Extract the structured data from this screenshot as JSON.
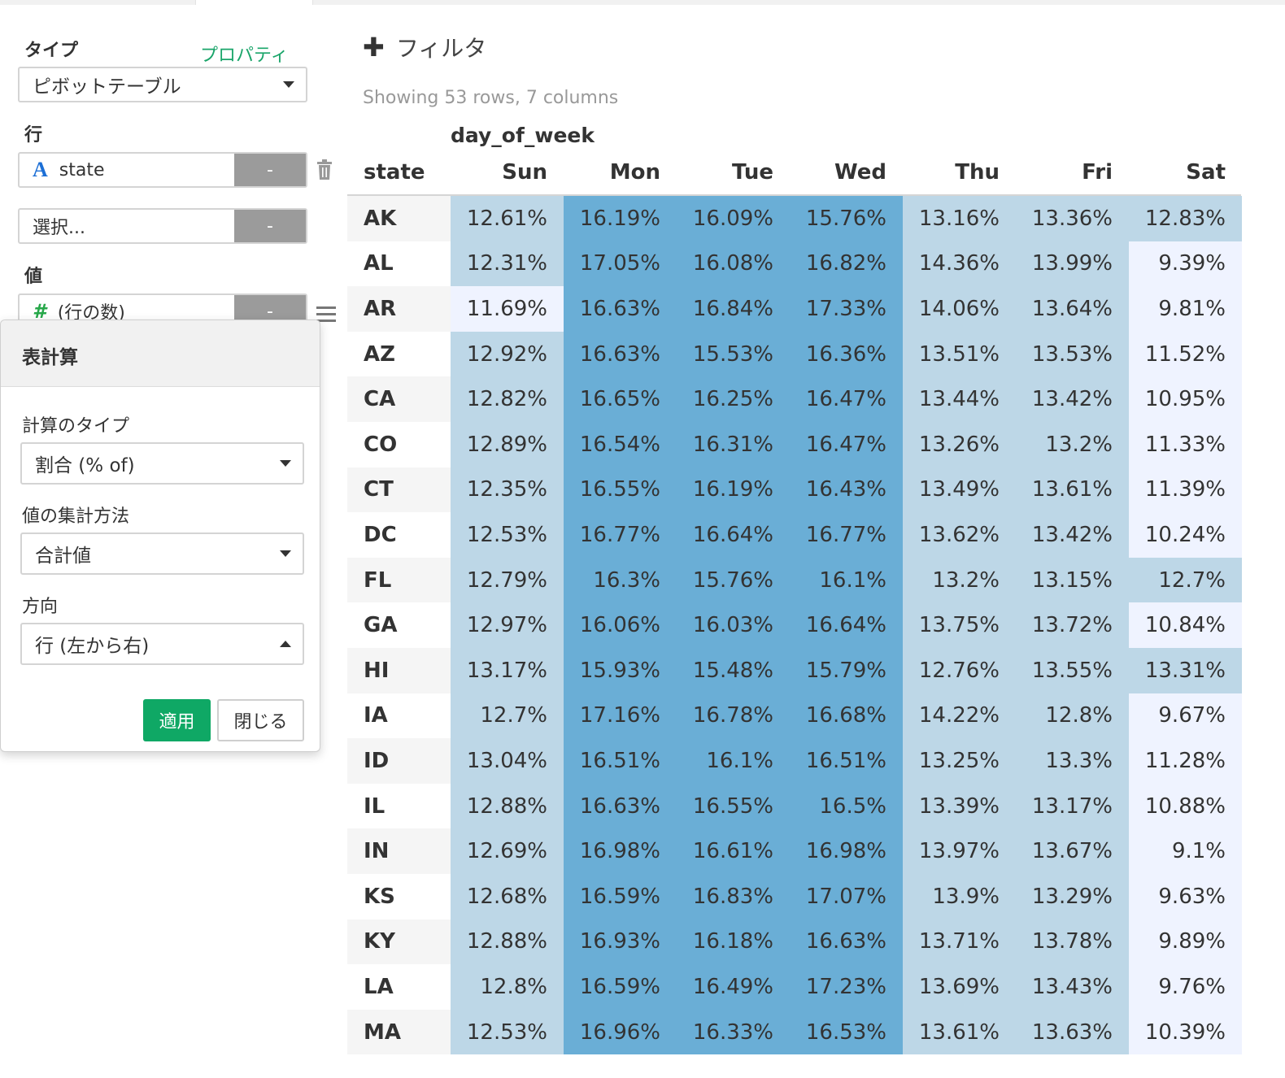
{
  "left": {
    "type_label": "タイプ",
    "properties_link": "プロパティ",
    "chart_type": "ピボットテーブル",
    "rows_label": "行",
    "row_field": "state",
    "field_minus": "-",
    "select_placeholder": "選択...",
    "values_label": "値",
    "value_field": "(行の数)"
  },
  "popup": {
    "title": "表計算",
    "calc_type_label": "計算のタイプ",
    "calc_type_value": "割合 (% of)",
    "agg_label": "値の集計方法",
    "agg_value": "合計値",
    "direction_label": "方向",
    "direction_value": "行 (左から右)",
    "apply": "適用",
    "close": "閉じる"
  },
  "main": {
    "filter_label": "フィルタ",
    "showing": "Showing 53 rows, 7 columns",
    "column_group": "day_of_week",
    "row_header": "state",
    "columns": [
      "Sun",
      "Mon",
      "Tue",
      "Wed",
      "Thu",
      "Fri",
      "Sat"
    ],
    "rows": [
      {
        "state": "AK",
        "values": [
          "12.61%",
          "16.19%",
          "16.09%",
          "15.76%",
          "13.16%",
          "13.36%",
          "12.83%"
        ]
      },
      {
        "state": "AL",
        "values": [
          "12.31%",
          "17.05%",
          "16.08%",
          "16.82%",
          "14.36%",
          "13.99%",
          "9.39%"
        ]
      },
      {
        "state": "AR",
        "values": [
          "11.69%",
          "16.63%",
          "16.84%",
          "17.33%",
          "14.06%",
          "13.64%",
          "9.81%"
        ]
      },
      {
        "state": "AZ",
        "values": [
          "12.92%",
          "16.63%",
          "15.53%",
          "16.36%",
          "13.51%",
          "13.53%",
          "11.52%"
        ]
      },
      {
        "state": "CA",
        "values": [
          "12.82%",
          "16.65%",
          "16.25%",
          "16.47%",
          "13.44%",
          "13.42%",
          "10.95%"
        ]
      },
      {
        "state": "CO",
        "values": [
          "12.89%",
          "16.54%",
          "16.31%",
          "16.47%",
          "13.26%",
          "13.2%",
          "11.33%"
        ]
      },
      {
        "state": "CT",
        "values": [
          "12.35%",
          "16.55%",
          "16.19%",
          "16.43%",
          "13.49%",
          "13.61%",
          "11.39%"
        ]
      },
      {
        "state": "DC",
        "values": [
          "12.53%",
          "16.77%",
          "16.64%",
          "16.77%",
          "13.62%",
          "13.42%",
          "10.24%"
        ]
      },
      {
        "state": "FL",
        "values": [
          "12.79%",
          "16.3%",
          "15.76%",
          "16.1%",
          "13.2%",
          "13.15%",
          "12.7%"
        ]
      },
      {
        "state": "GA",
        "values": [
          "12.97%",
          "16.06%",
          "16.03%",
          "16.64%",
          "13.75%",
          "13.72%",
          "10.84%"
        ]
      },
      {
        "state": "HI",
        "values": [
          "13.17%",
          "15.93%",
          "15.48%",
          "15.79%",
          "12.76%",
          "13.55%",
          "13.31%"
        ]
      },
      {
        "state": "IA",
        "values": [
          "12.7%",
          "17.16%",
          "16.78%",
          "16.68%",
          "14.22%",
          "12.8%",
          "9.67%"
        ]
      },
      {
        "state": "ID",
        "values": [
          "13.04%",
          "16.51%",
          "16.1%",
          "16.51%",
          "13.25%",
          "13.3%",
          "11.28%"
        ]
      },
      {
        "state": "IL",
        "values": [
          "12.88%",
          "16.63%",
          "16.55%",
          "16.5%",
          "13.39%",
          "13.17%",
          "10.88%"
        ]
      },
      {
        "state": "IN",
        "values": [
          "12.69%",
          "16.98%",
          "16.61%",
          "16.98%",
          "13.97%",
          "13.67%",
          "9.1%"
        ]
      },
      {
        "state": "KS",
        "values": [
          "12.68%",
          "16.59%",
          "16.83%",
          "17.07%",
          "13.9%",
          "13.29%",
          "9.63%"
        ]
      },
      {
        "state": "KY",
        "values": [
          "12.88%",
          "16.93%",
          "16.18%",
          "16.63%",
          "13.71%",
          "13.78%",
          "9.89%"
        ]
      },
      {
        "state": "LA",
        "values": [
          "12.8%",
          "16.59%",
          "16.49%",
          "17.23%",
          "13.69%",
          "13.43%",
          "9.76%"
        ]
      },
      {
        "state": "MA",
        "values": [
          "12.53%",
          "16.96%",
          "16.33%",
          "16.53%",
          "13.61%",
          "13.63%",
          "10.39%"
        ]
      }
    ]
  },
  "colors": {
    "accent_green": "#0fa865",
    "heat_high": "#6aaed6",
    "heat_mid": "#bdd7e7",
    "heat_low": "#eff3ff"
  }
}
